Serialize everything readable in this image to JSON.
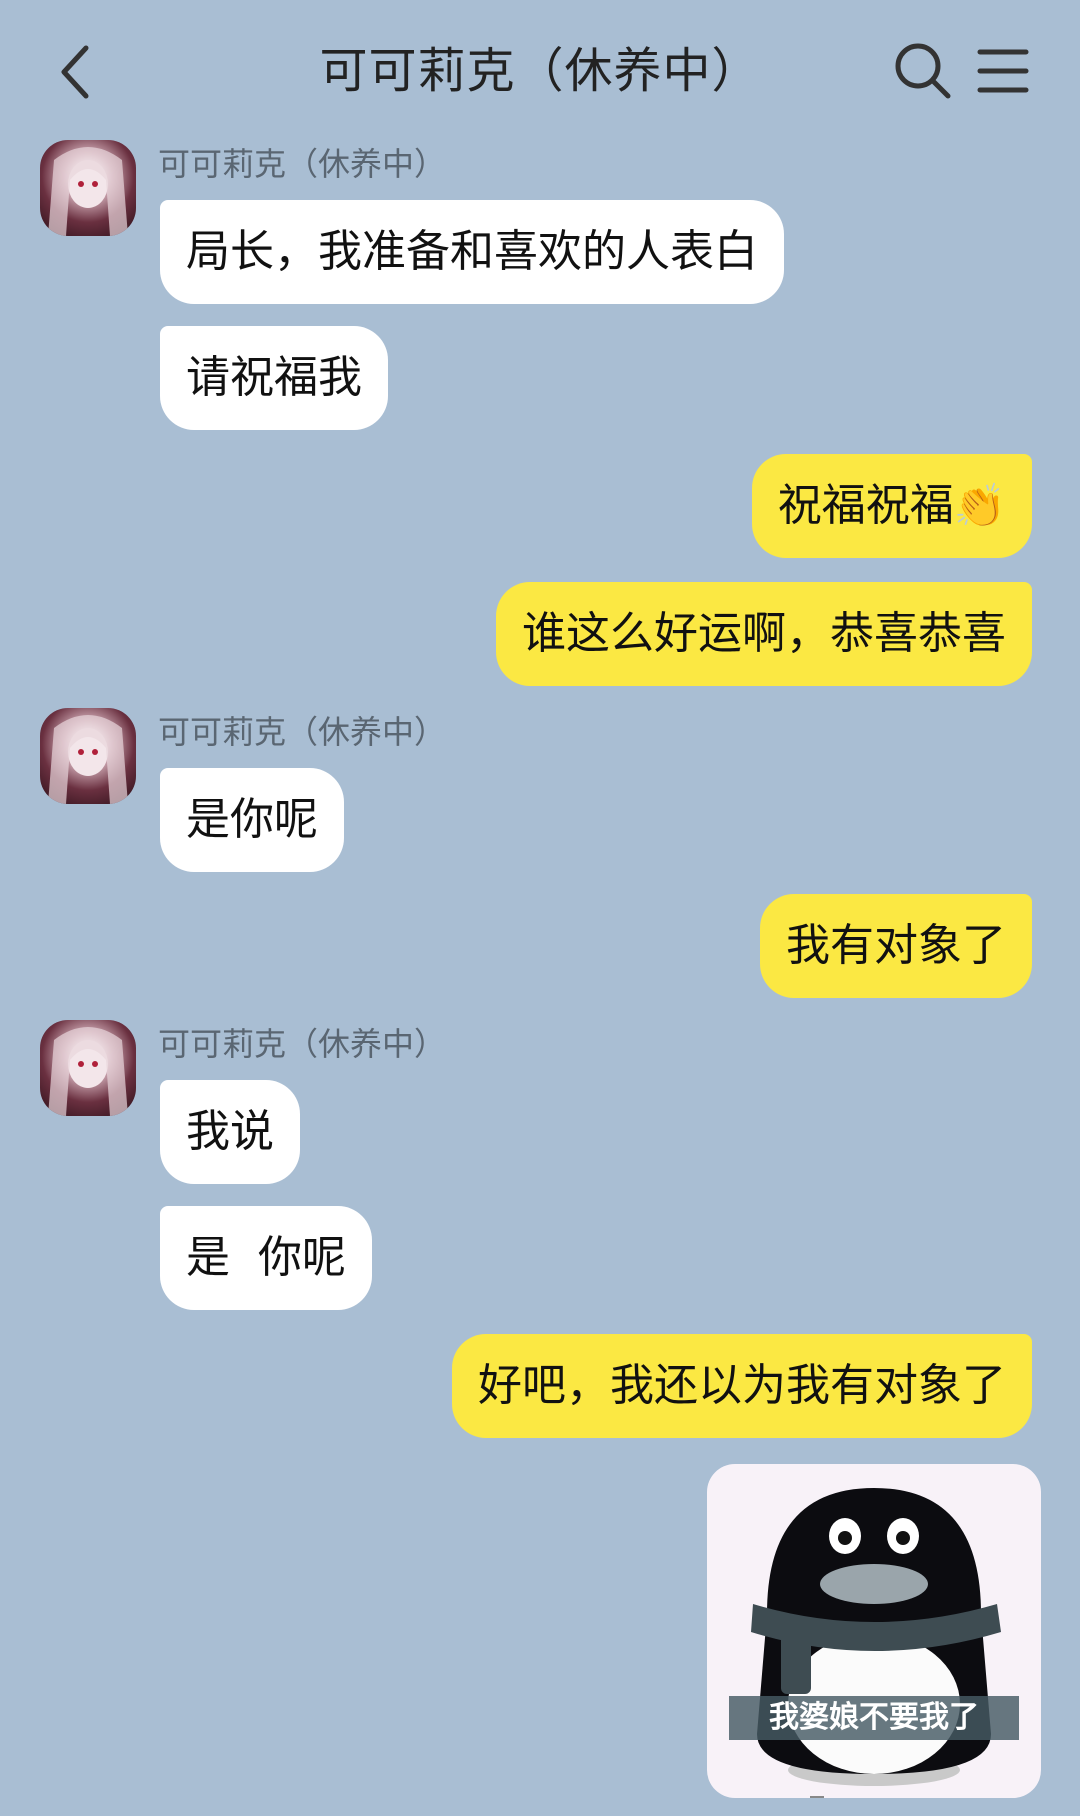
{
  "header": {
    "title": "可可莉克（休养中）",
    "back_icon": "chevron-left-icon",
    "search_icon": "search-icon",
    "menu_icon": "menu-icon"
  },
  "contact": {
    "name": "可可莉克（休养中）"
  },
  "messages": [
    {
      "side": "in",
      "text": "局长，我准备和喜欢的人表白"
    },
    {
      "side": "in",
      "text": "请祝福我"
    },
    {
      "side": "out",
      "text": "祝福祝福",
      "emoji": "👏"
    },
    {
      "side": "out",
      "text": "谁这么好运啊，恭喜恭喜"
    },
    {
      "side": "in",
      "text": "是你呢"
    },
    {
      "side": "out",
      "text": "我有对象了"
    },
    {
      "side": "in",
      "text": "我说"
    },
    {
      "side": "in",
      "text": "是  你呢"
    },
    {
      "side": "out",
      "text": "好吧，我还以为我有对象了"
    }
  ],
  "sticker": {
    "caption": "我婆娘不要我了"
  },
  "colors": {
    "background": "#a9bed3",
    "incoming": "#ffffff",
    "outgoing": "#fbe843"
  }
}
